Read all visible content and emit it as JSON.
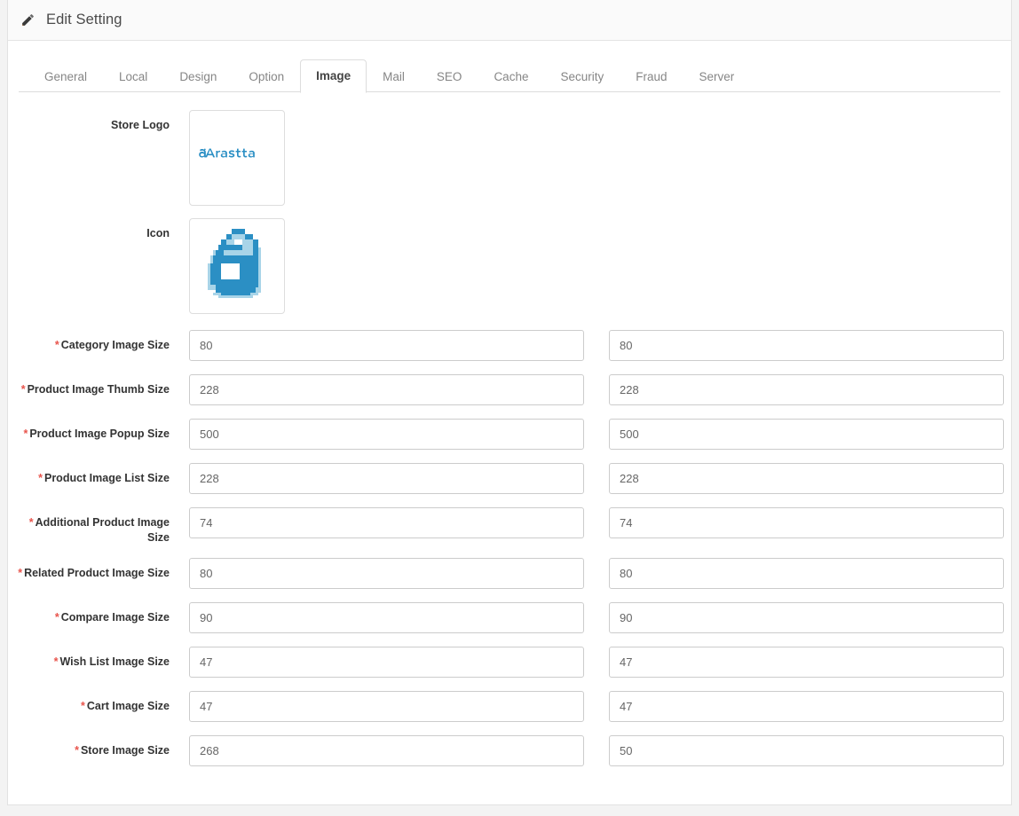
{
  "header": {
    "title": "Edit Setting",
    "icon": "pencil-icon"
  },
  "tabs": [
    {
      "label": "General",
      "active": false
    },
    {
      "label": "Local",
      "active": false
    },
    {
      "label": "Design",
      "active": false
    },
    {
      "label": "Option",
      "active": false
    },
    {
      "label": "Image",
      "active": true
    },
    {
      "label": "Mail",
      "active": false
    },
    {
      "label": "SEO",
      "active": false
    },
    {
      "label": "Cache",
      "active": false
    },
    {
      "label": "Security",
      "active": false
    },
    {
      "label": "Fraud",
      "active": false
    },
    {
      "label": "Server",
      "active": false
    }
  ],
  "images": {
    "store_logo": {
      "label": "Store Logo",
      "alt": "Arastta logo",
      "brand_color": "#2b8fc4"
    },
    "icon": {
      "label": "Icon",
      "alt": "Arastta favicon",
      "brand_color": "#2b8fc4",
      "brand_color_light": "#a8d4e8"
    }
  },
  "size_fields": [
    {
      "label": "Category Image Size",
      "required": true,
      "width": "80",
      "height": "80"
    },
    {
      "label": "Product Image Thumb Size",
      "required": true,
      "width": "228",
      "height": "228"
    },
    {
      "label": "Product Image Popup Size",
      "required": true,
      "width": "500",
      "height": "500"
    },
    {
      "label": "Product Image List Size",
      "required": true,
      "width": "228",
      "height": "228"
    },
    {
      "label": "Additional Product Image Size",
      "required": true,
      "width": "74",
      "height": "74"
    },
    {
      "label": "Related Product Image Size",
      "required": true,
      "width": "80",
      "height": "80"
    },
    {
      "label": "Compare Image Size",
      "required": true,
      "width": "90",
      "height": "90"
    },
    {
      "label": "Wish List Image Size",
      "required": true,
      "width": "47",
      "height": "47"
    },
    {
      "label": "Cart Image Size",
      "required": true,
      "width": "47",
      "height": "47"
    },
    {
      "label": "Store Image Size",
      "required": true,
      "width": "268",
      "height": "50"
    }
  ],
  "colors": {
    "required_marker": "#e8544c",
    "panel_header_bg": "#fafafa",
    "border": "#e2e2e2",
    "tab_inactive_text": "#868686",
    "tab_active_text": "#444444"
  }
}
